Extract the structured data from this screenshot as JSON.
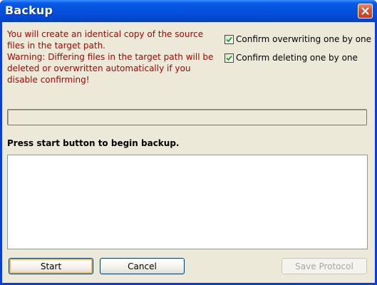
{
  "window": {
    "title": "Backup",
    "close_icon": "close-icon"
  },
  "info": {
    "line1": "You will create an identical copy of the source files in the target path.",
    "line2": "Warning: Differing files in the target path will be deleted or overwritten automatically if you disable confirming!"
  },
  "options": [
    {
      "label": "Confirm overwriting one by one",
      "checked": true
    },
    {
      "label": "Confirm deleting one by one",
      "checked": true
    }
  ],
  "progress": {
    "value": 0
  },
  "status": "Press start button to begin backup.",
  "log": {
    "content": ""
  },
  "buttons": {
    "start": "Start",
    "cancel": "Cancel",
    "save_protocol": "Save Protocol"
  },
  "colors": {
    "warning_text": "#b00000",
    "titlebar": "#0453df",
    "dialog_bg": "#ece9d8"
  }
}
